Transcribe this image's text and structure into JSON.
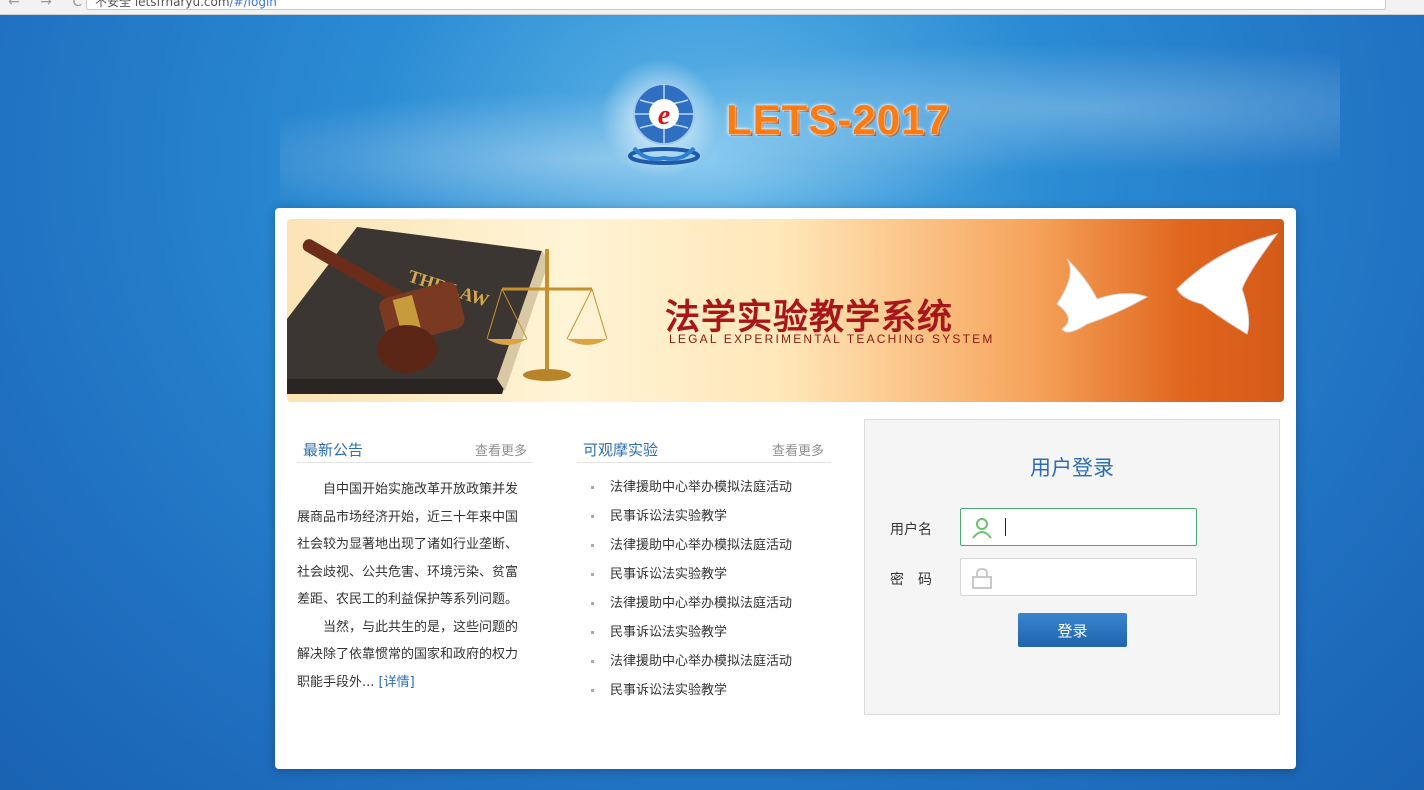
{
  "browser": {
    "nav_icons": "← → C",
    "address_security": "不安全",
    "address_host": "letsfrnaryu.com",
    "address_path": "/#/login"
  },
  "header": {
    "logo_text": "LETS-2017"
  },
  "banner": {
    "book_text": "THE LAW",
    "title_cn": "法学实验教学系统",
    "title_en": "LEGAL EXPERIMENTAL TEACHING SYSTEM"
  },
  "notices": {
    "title": "最新公告",
    "more": "查看更多",
    "paragraph1": "自中国开始实施改革开放政策并发展商品市场经济开始，近三十年来中国社会较为显著地出现了诸如行业垄断、社会歧视、公共危害、环境污染、贫富差距、农民工的利益保护等系列问题。",
    "paragraph2": "当然，与此共生的是，这些问题的解决除了依靠惯常的国家和政府的权力职能手段外...",
    "detail_link": "[详情]"
  },
  "experiments": {
    "title": "可观摩实验",
    "more": "查看更多",
    "items": [
      "法律援助中心举办模拟法庭活动",
      "民事诉讼法实验教学",
      "法律援助中心举办模拟法庭活动",
      "民事诉讼法实验教学",
      "法律援助中心举办模拟法庭活动",
      "民事诉讼法实验教学",
      "法律援助中心举办模拟法庭活动",
      "民事诉讼法实验教学"
    ]
  },
  "login": {
    "title": "用户登录",
    "username_label": "用户名",
    "password_label": "密　码",
    "username_value": "",
    "password_value": "",
    "submit_label": "登录",
    "accent_color": "#2d6eb2",
    "active_border_color": "#4cae6e"
  }
}
